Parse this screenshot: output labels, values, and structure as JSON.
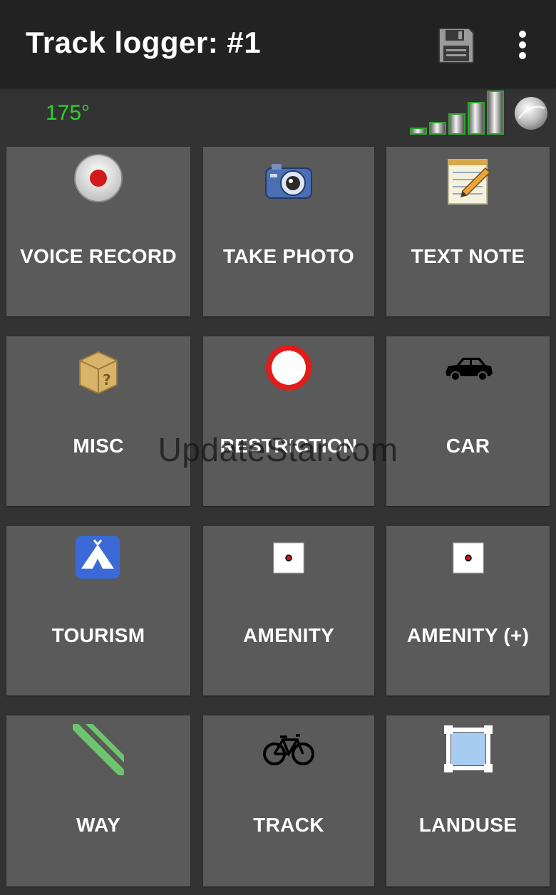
{
  "toolbar": {
    "title": "Track logger: #1",
    "save_icon": "floppy-disk-icon",
    "menu_icon": "overflow-menu-icon"
  },
  "status": {
    "heading": "175°",
    "heading_color": "#2ed12e",
    "signal_icon": "signal-strength-icon",
    "gps_icon": "gps-status-icon"
  },
  "tiles": [
    {
      "label": "VOICE RECORD",
      "icon": "record-icon"
    },
    {
      "label": "TAKE PHOTO",
      "icon": "camera-icon"
    },
    {
      "label": "TEXT NOTE",
      "icon": "notepad-icon"
    },
    {
      "label": "MISC",
      "icon": "box-question-icon"
    },
    {
      "label": "RESTRICTION",
      "icon": "no-entry-sign-icon"
    },
    {
      "label": "CAR",
      "icon": "car-icon"
    },
    {
      "label": "TOURISM",
      "icon": "tent-icon"
    },
    {
      "label": "AMENITY",
      "icon": "amenity-dot-icon"
    },
    {
      "label": "AMENITY (+)",
      "icon": "amenity-dot-icon"
    },
    {
      "label": "WAY",
      "icon": "road-stripe-icon"
    },
    {
      "label": "TRACK",
      "icon": "bicycle-icon"
    },
    {
      "label": "LANDUSE",
      "icon": "area-frame-icon"
    }
  ],
  "watermark": "UpdateStar.com",
  "colors": {
    "background": "#333333",
    "toolbar": "#222222",
    "tile": "#5a5a5a"
  }
}
